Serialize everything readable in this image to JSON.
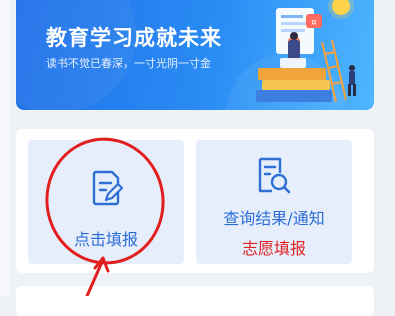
{
  "banner": {
    "title": "教育学习成就未来",
    "subtitle": "读书不觉已春深，一寸光阴一寸金"
  },
  "tiles": [
    {
      "label": "点击填报",
      "icon": "edit-form-icon"
    },
    {
      "label": "查询结果/通知",
      "sublabel": "志愿填报",
      "icon": "search-document-icon"
    }
  ],
  "colors": {
    "primary": "#2e6fd6",
    "tile_bg": "#e6eefb",
    "annotation_red": "#e21f1f",
    "page_bg": "#eef1f6"
  }
}
